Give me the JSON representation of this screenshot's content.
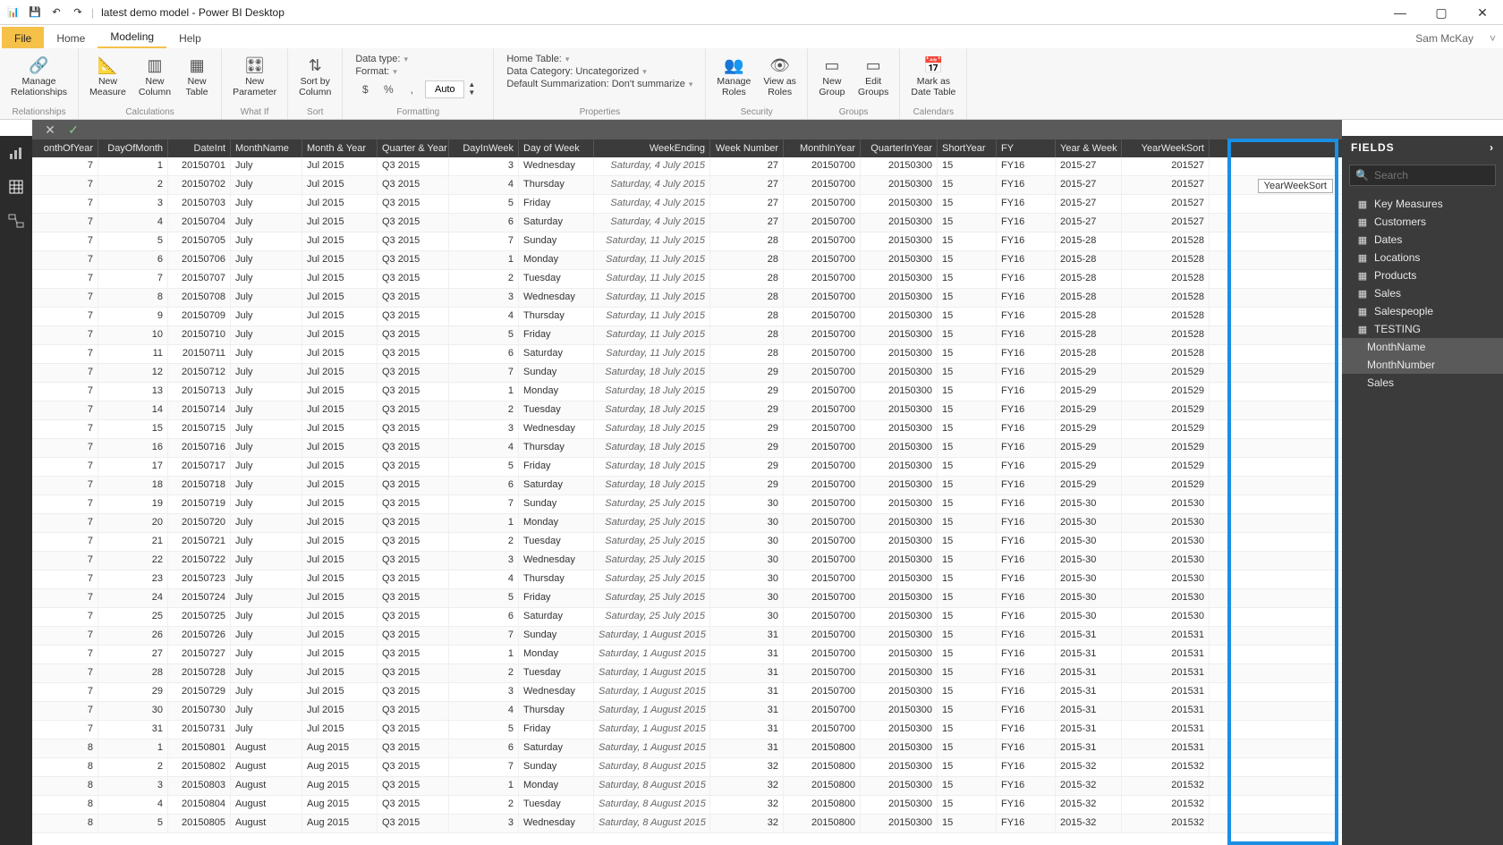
{
  "window": {
    "title": "latest demo model - Power BI Desktop",
    "user": "Sam McKay"
  },
  "tabs": {
    "file": "File",
    "home": "Home",
    "modeling": "Modeling",
    "help": "Help"
  },
  "ribbon": {
    "relationships": {
      "manage": "Manage\nRelationships",
      "group": "Relationships"
    },
    "calculations": {
      "measure": "New\nMeasure",
      "column": "New\nColumn",
      "table": "New\nTable",
      "group": "Calculations"
    },
    "whatif": {
      "param": "New\nParameter",
      "group": "What If"
    },
    "sort": {
      "sortby": "Sort by\nColumn",
      "group": "Sort"
    },
    "formatting": {
      "dataType": "Data type:",
      "format": "Format:",
      "auto": "Auto",
      "group": "Formatting"
    },
    "properties": {
      "homeTable": "Home Table:",
      "dataCat": "Data Category: Uncategorized",
      "defSum": "Default Summarization: Don't summarize",
      "group": "Properties"
    },
    "security": {
      "manage": "Manage\nRoles",
      "viewas": "View as\nRoles",
      "group": "Security"
    },
    "groups": {
      "new": "New\nGroup",
      "edit": "Edit\nGroups",
      "group": "Groups"
    },
    "calendars": {
      "mark": "Mark as\nDate Table",
      "group": "Calendars"
    }
  },
  "tooltip": "YearWeekSort",
  "columns": [
    "onthOfYear",
    "DayOfMonth",
    "DateInt",
    "MonthName",
    "Month & Year",
    "Quarter & Year",
    "DayInWeek",
    "Day of Week",
    "WeekEnding",
    "Week Number",
    "MonthInYear",
    "QuarterInYear",
    "ShortYear",
    "FY",
    "Year & Week",
    "YearWeekSort"
  ],
  "rows": [
    {
      "m": 7,
      "d": 1,
      "di": 20150701,
      "mn": "July",
      "my": "Jul 2015",
      "qy": "Q3 2015",
      "dw": 3,
      "down": "Wednesday",
      "we": "Saturday, 4 July 2015",
      "wn": 27,
      "miy": 20150700,
      "qiy": 20150300,
      "sy": 15,
      "fy": "FY16",
      "yw": "2015-27",
      "yws": 201527
    },
    {
      "m": 7,
      "d": 2,
      "di": 20150702,
      "mn": "July",
      "my": "Jul 2015",
      "qy": "Q3 2015",
      "dw": 4,
      "down": "Thursday",
      "we": "Saturday, 4 July 2015",
      "wn": 27,
      "miy": 20150700,
      "qiy": 20150300,
      "sy": 15,
      "fy": "FY16",
      "yw": "2015-27",
      "yws": 201527
    },
    {
      "m": 7,
      "d": 3,
      "di": 20150703,
      "mn": "July",
      "my": "Jul 2015",
      "qy": "Q3 2015",
      "dw": 5,
      "down": "Friday",
      "we": "Saturday, 4 July 2015",
      "wn": 27,
      "miy": 20150700,
      "qiy": 20150300,
      "sy": 15,
      "fy": "FY16",
      "yw": "2015-27",
      "yws": 201527
    },
    {
      "m": 7,
      "d": 4,
      "di": 20150704,
      "mn": "July",
      "my": "Jul 2015",
      "qy": "Q3 2015",
      "dw": 6,
      "down": "Saturday",
      "we": "Saturday, 4 July 2015",
      "wn": 27,
      "miy": 20150700,
      "qiy": 20150300,
      "sy": 15,
      "fy": "FY16",
      "yw": "2015-27",
      "yws": 201527
    },
    {
      "m": 7,
      "d": 5,
      "di": 20150705,
      "mn": "July",
      "my": "Jul 2015",
      "qy": "Q3 2015",
      "dw": 7,
      "down": "Sunday",
      "we": "Saturday, 11 July 2015",
      "wn": 28,
      "miy": 20150700,
      "qiy": 20150300,
      "sy": 15,
      "fy": "FY16",
      "yw": "2015-28",
      "yws": 201528
    },
    {
      "m": 7,
      "d": 6,
      "di": 20150706,
      "mn": "July",
      "my": "Jul 2015",
      "qy": "Q3 2015",
      "dw": 1,
      "down": "Monday",
      "we": "Saturday, 11 July 2015",
      "wn": 28,
      "miy": 20150700,
      "qiy": 20150300,
      "sy": 15,
      "fy": "FY16",
      "yw": "2015-28",
      "yws": 201528
    },
    {
      "m": 7,
      "d": 7,
      "di": 20150707,
      "mn": "July",
      "my": "Jul 2015",
      "qy": "Q3 2015",
      "dw": 2,
      "down": "Tuesday",
      "we": "Saturday, 11 July 2015",
      "wn": 28,
      "miy": 20150700,
      "qiy": 20150300,
      "sy": 15,
      "fy": "FY16",
      "yw": "2015-28",
      "yws": 201528
    },
    {
      "m": 7,
      "d": 8,
      "di": 20150708,
      "mn": "July",
      "my": "Jul 2015",
      "qy": "Q3 2015",
      "dw": 3,
      "down": "Wednesday",
      "we": "Saturday, 11 July 2015",
      "wn": 28,
      "miy": 20150700,
      "qiy": 20150300,
      "sy": 15,
      "fy": "FY16",
      "yw": "2015-28",
      "yws": 201528
    },
    {
      "m": 7,
      "d": 9,
      "di": 20150709,
      "mn": "July",
      "my": "Jul 2015",
      "qy": "Q3 2015",
      "dw": 4,
      "down": "Thursday",
      "we": "Saturday, 11 July 2015",
      "wn": 28,
      "miy": 20150700,
      "qiy": 20150300,
      "sy": 15,
      "fy": "FY16",
      "yw": "2015-28",
      "yws": 201528
    },
    {
      "m": 7,
      "d": 10,
      "di": 20150710,
      "mn": "July",
      "my": "Jul 2015",
      "qy": "Q3 2015",
      "dw": 5,
      "down": "Friday",
      "we": "Saturday, 11 July 2015",
      "wn": 28,
      "miy": 20150700,
      "qiy": 20150300,
      "sy": 15,
      "fy": "FY16",
      "yw": "2015-28",
      "yws": 201528
    },
    {
      "m": 7,
      "d": 11,
      "di": 20150711,
      "mn": "July",
      "my": "Jul 2015",
      "qy": "Q3 2015",
      "dw": 6,
      "down": "Saturday",
      "we": "Saturday, 11 July 2015",
      "wn": 28,
      "miy": 20150700,
      "qiy": 20150300,
      "sy": 15,
      "fy": "FY16",
      "yw": "2015-28",
      "yws": 201528
    },
    {
      "m": 7,
      "d": 12,
      "di": 20150712,
      "mn": "July",
      "my": "Jul 2015",
      "qy": "Q3 2015",
      "dw": 7,
      "down": "Sunday",
      "we": "Saturday, 18 July 2015",
      "wn": 29,
      "miy": 20150700,
      "qiy": 20150300,
      "sy": 15,
      "fy": "FY16",
      "yw": "2015-29",
      "yws": 201529
    },
    {
      "m": 7,
      "d": 13,
      "di": 20150713,
      "mn": "July",
      "my": "Jul 2015",
      "qy": "Q3 2015",
      "dw": 1,
      "down": "Monday",
      "we": "Saturday, 18 July 2015",
      "wn": 29,
      "miy": 20150700,
      "qiy": 20150300,
      "sy": 15,
      "fy": "FY16",
      "yw": "2015-29",
      "yws": 201529
    },
    {
      "m": 7,
      "d": 14,
      "di": 20150714,
      "mn": "July",
      "my": "Jul 2015",
      "qy": "Q3 2015",
      "dw": 2,
      "down": "Tuesday",
      "we": "Saturday, 18 July 2015",
      "wn": 29,
      "miy": 20150700,
      "qiy": 20150300,
      "sy": 15,
      "fy": "FY16",
      "yw": "2015-29",
      "yws": 201529
    },
    {
      "m": 7,
      "d": 15,
      "di": 20150715,
      "mn": "July",
      "my": "Jul 2015",
      "qy": "Q3 2015",
      "dw": 3,
      "down": "Wednesday",
      "we": "Saturday, 18 July 2015",
      "wn": 29,
      "miy": 20150700,
      "qiy": 20150300,
      "sy": 15,
      "fy": "FY16",
      "yw": "2015-29",
      "yws": 201529
    },
    {
      "m": 7,
      "d": 16,
      "di": 20150716,
      "mn": "July",
      "my": "Jul 2015",
      "qy": "Q3 2015",
      "dw": 4,
      "down": "Thursday",
      "we": "Saturday, 18 July 2015",
      "wn": 29,
      "miy": 20150700,
      "qiy": 20150300,
      "sy": 15,
      "fy": "FY16",
      "yw": "2015-29",
      "yws": 201529
    },
    {
      "m": 7,
      "d": 17,
      "di": 20150717,
      "mn": "July",
      "my": "Jul 2015",
      "qy": "Q3 2015",
      "dw": 5,
      "down": "Friday",
      "we": "Saturday, 18 July 2015",
      "wn": 29,
      "miy": 20150700,
      "qiy": 20150300,
      "sy": 15,
      "fy": "FY16",
      "yw": "2015-29",
      "yws": 201529
    },
    {
      "m": 7,
      "d": 18,
      "di": 20150718,
      "mn": "July",
      "my": "Jul 2015",
      "qy": "Q3 2015",
      "dw": 6,
      "down": "Saturday",
      "we": "Saturday, 18 July 2015",
      "wn": 29,
      "miy": 20150700,
      "qiy": 20150300,
      "sy": 15,
      "fy": "FY16",
      "yw": "2015-29",
      "yws": 201529
    },
    {
      "m": 7,
      "d": 19,
      "di": 20150719,
      "mn": "July",
      "my": "Jul 2015",
      "qy": "Q3 2015",
      "dw": 7,
      "down": "Sunday",
      "we": "Saturday, 25 July 2015",
      "wn": 30,
      "miy": 20150700,
      "qiy": 20150300,
      "sy": 15,
      "fy": "FY16",
      "yw": "2015-30",
      "yws": 201530
    },
    {
      "m": 7,
      "d": 20,
      "di": 20150720,
      "mn": "July",
      "my": "Jul 2015",
      "qy": "Q3 2015",
      "dw": 1,
      "down": "Monday",
      "we": "Saturday, 25 July 2015",
      "wn": 30,
      "miy": 20150700,
      "qiy": 20150300,
      "sy": 15,
      "fy": "FY16",
      "yw": "2015-30",
      "yws": 201530
    },
    {
      "m": 7,
      "d": 21,
      "di": 20150721,
      "mn": "July",
      "my": "Jul 2015",
      "qy": "Q3 2015",
      "dw": 2,
      "down": "Tuesday",
      "we": "Saturday, 25 July 2015",
      "wn": 30,
      "miy": 20150700,
      "qiy": 20150300,
      "sy": 15,
      "fy": "FY16",
      "yw": "2015-30",
      "yws": 201530
    },
    {
      "m": 7,
      "d": 22,
      "di": 20150722,
      "mn": "July",
      "my": "Jul 2015",
      "qy": "Q3 2015",
      "dw": 3,
      "down": "Wednesday",
      "we": "Saturday, 25 July 2015",
      "wn": 30,
      "miy": 20150700,
      "qiy": 20150300,
      "sy": 15,
      "fy": "FY16",
      "yw": "2015-30",
      "yws": 201530
    },
    {
      "m": 7,
      "d": 23,
      "di": 20150723,
      "mn": "July",
      "my": "Jul 2015",
      "qy": "Q3 2015",
      "dw": 4,
      "down": "Thursday",
      "we": "Saturday, 25 July 2015",
      "wn": 30,
      "miy": 20150700,
      "qiy": 20150300,
      "sy": 15,
      "fy": "FY16",
      "yw": "2015-30",
      "yws": 201530
    },
    {
      "m": 7,
      "d": 24,
      "di": 20150724,
      "mn": "July",
      "my": "Jul 2015",
      "qy": "Q3 2015",
      "dw": 5,
      "down": "Friday",
      "we": "Saturday, 25 July 2015",
      "wn": 30,
      "miy": 20150700,
      "qiy": 20150300,
      "sy": 15,
      "fy": "FY16",
      "yw": "2015-30",
      "yws": 201530
    },
    {
      "m": 7,
      "d": 25,
      "di": 20150725,
      "mn": "July",
      "my": "Jul 2015",
      "qy": "Q3 2015",
      "dw": 6,
      "down": "Saturday",
      "we": "Saturday, 25 July 2015",
      "wn": 30,
      "miy": 20150700,
      "qiy": 20150300,
      "sy": 15,
      "fy": "FY16",
      "yw": "2015-30",
      "yws": 201530
    },
    {
      "m": 7,
      "d": 26,
      "di": 20150726,
      "mn": "July",
      "my": "Jul 2015",
      "qy": "Q3 2015",
      "dw": 7,
      "down": "Sunday",
      "we": "Saturday, 1 August 2015",
      "wn": 31,
      "miy": 20150700,
      "qiy": 20150300,
      "sy": 15,
      "fy": "FY16",
      "yw": "2015-31",
      "yws": 201531
    },
    {
      "m": 7,
      "d": 27,
      "di": 20150727,
      "mn": "July",
      "my": "Jul 2015",
      "qy": "Q3 2015",
      "dw": 1,
      "down": "Monday",
      "we": "Saturday, 1 August 2015",
      "wn": 31,
      "miy": 20150700,
      "qiy": 20150300,
      "sy": 15,
      "fy": "FY16",
      "yw": "2015-31",
      "yws": 201531
    },
    {
      "m": 7,
      "d": 28,
      "di": 20150728,
      "mn": "July",
      "my": "Jul 2015",
      "qy": "Q3 2015",
      "dw": 2,
      "down": "Tuesday",
      "we": "Saturday, 1 August 2015",
      "wn": 31,
      "miy": 20150700,
      "qiy": 20150300,
      "sy": 15,
      "fy": "FY16",
      "yw": "2015-31",
      "yws": 201531
    },
    {
      "m": 7,
      "d": 29,
      "di": 20150729,
      "mn": "July",
      "my": "Jul 2015",
      "qy": "Q3 2015",
      "dw": 3,
      "down": "Wednesday",
      "we": "Saturday, 1 August 2015",
      "wn": 31,
      "miy": 20150700,
      "qiy": 20150300,
      "sy": 15,
      "fy": "FY16",
      "yw": "2015-31",
      "yws": 201531
    },
    {
      "m": 7,
      "d": 30,
      "di": 20150730,
      "mn": "July",
      "my": "Jul 2015",
      "qy": "Q3 2015",
      "dw": 4,
      "down": "Thursday",
      "we": "Saturday, 1 August 2015",
      "wn": 31,
      "miy": 20150700,
      "qiy": 20150300,
      "sy": 15,
      "fy": "FY16",
      "yw": "2015-31",
      "yws": 201531
    },
    {
      "m": 7,
      "d": 31,
      "di": 20150731,
      "mn": "July",
      "my": "Jul 2015",
      "qy": "Q3 2015",
      "dw": 5,
      "down": "Friday",
      "we": "Saturday, 1 August 2015",
      "wn": 31,
      "miy": 20150700,
      "qiy": 20150300,
      "sy": 15,
      "fy": "FY16",
      "yw": "2015-31",
      "yws": 201531
    },
    {
      "m": 8,
      "d": 1,
      "di": 20150801,
      "mn": "August",
      "my": "Aug 2015",
      "qy": "Q3 2015",
      "dw": 6,
      "down": "Saturday",
      "we": "Saturday, 1 August 2015",
      "wn": 31,
      "miy": 20150800,
      "qiy": 20150300,
      "sy": 15,
      "fy": "FY16",
      "yw": "2015-31",
      "yws": 201531
    },
    {
      "m": 8,
      "d": 2,
      "di": 20150802,
      "mn": "August",
      "my": "Aug 2015",
      "qy": "Q3 2015",
      "dw": 7,
      "down": "Sunday",
      "we": "Saturday, 8 August 2015",
      "wn": 32,
      "miy": 20150800,
      "qiy": 20150300,
      "sy": 15,
      "fy": "FY16",
      "yw": "2015-32",
      "yws": 201532
    },
    {
      "m": 8,
      "d": 3,
      "di": 20150803,
      "mn": "August",
      "my": "Aug 2015",
      "qy": "Q3 2015",
      "dw": 1,
      "down": "Monday",
      "we": "Saturday, 8 August 2015",
      "wn": 32,
      "miy": 20150800,
      "qiy": 20150300,
      "sy": 15,
      "fy": "FY16",
      "yw": "2015-32",
      "yws": 201532
    },
    {
      "m": 8,
      "d": 4,
      "di": 20150804,
      "mn": "August",
      "my": "Aug 2015",
      "qy": "Q3 2015",
      "dw": 2,
      "down": "Tuesday",
      "we": "Saturday, 8 August 2015",
      "wn": 32,
      "miy": 20150800,
      "qiy": 20150300,
      "sy": 15,
      "fy": "FY16",
      "yw": "2015-32",
      "yws": 201532
    },
    {
      "m": 8,
      "d": 5,
      "di": 20150805,
      "mn": "August",
      "my": "Aug 2015",
      "qy": "Q3 2015",
      "dw": 3,
      "down": "Wednesday",
      "we": "Saturday, 8 August 2015",
      "wn": 32,
      "miy": 20150800,
      "qiy": 20150300,
      "sy": 15,
      "fy": "FY16",
      "yw": "2015-32",
      "yws": 201532
    }
  ],
  "fields": {
    "title": "FIELDS",
    "search_placeholder": "Search",
    "tables": [
      "Key Measures",
      "Customers",
      "Dates",
      "Locations",
      "Products",
      "Sales",
      "Salespeople",
      "TESTING"
    ],
    "selected": [
      "MonthName",
      "MonthNumber",
      "Sales"
    ]
  }
}
